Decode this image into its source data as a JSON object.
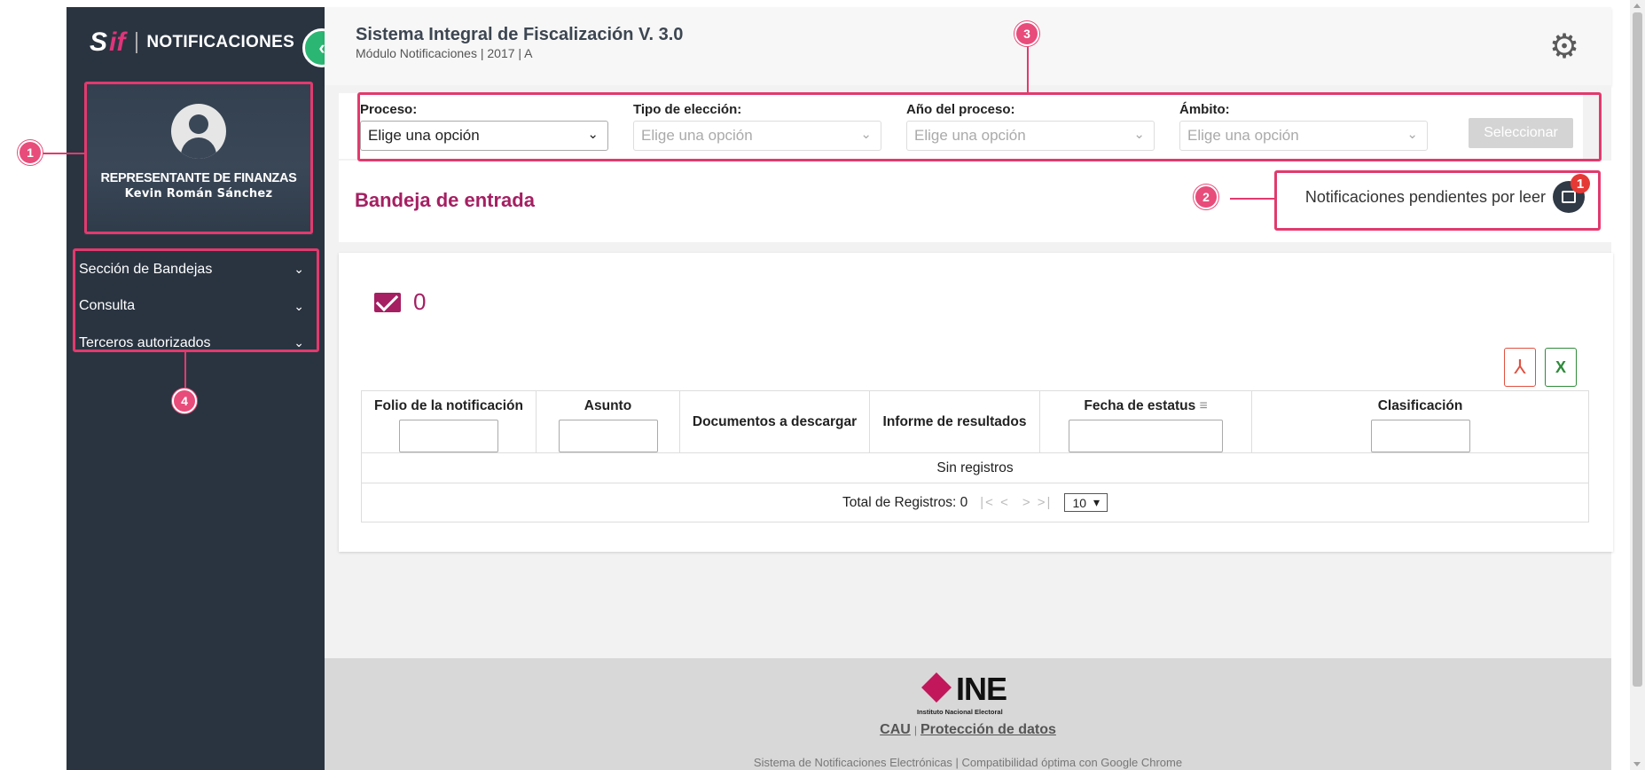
{
  "sidebar": {
    "logo_s": "S",
    "logo_if": "if",
    "title": "NOTIFICACIONES",
    "collapse_glyph": "‹",
    "profile": {
      "role": "REPRESENTANTE DE FINANZAS",
      "name": "Kevin Román Sánchez"
    },
    "menu": [
      {
        "label": "Sección de Bandejas",
        "chevron": "⌄"
      },
      {
        "label": "Consulta",
        "chevron": "⌄"
      },
      {
        "label": "Terceros autorizados",
        "chevron": "⌄"
      }
    ]
  },
  "header": {
    "title": "Sistema Integral de Fiscalización V. 3.0",
    "subtitle": "Módulo Notificaciones | 2017 | A",
    "settings_icon": "gear-icon"
  },
  "filters": {
    "proceso": {
      "label": "Proceso:",
      "value": "Elige una opción"
    },
    "tipo": {
      "label": "Tipo de elección:",
      "value": "Elige una opción"
    },
    "anio": {
      "label": "Año del proceso:",
      "value": "Elige una opción"
    },
    "ambito": {
      "label": "Ámbito:",
      "value": "Elige una opción"
    },
    "button": "Seleccionar"
  },
  "inbox": {
    "title": "Bandeja de entrada",
    "pending_label": "Notificaciones pendientes por leer",
    "pending_count": "1",
    "mail_count": "0"
  },
  "table": {
    "columns": [
      "Folio de la notificación",
      "Asunto",
      "Documentos a descargar",
      "Informe de resultados",
      "Fecha de estatus",
      "Clasificación"
    ],
    "sort_glyph": "≡",
    "empty": "Sin registros",
    "total_label": "Total de Registros: 0",
    "pager_first_prev": "|< <",
    "pager_next_last": "> >|",
    "page_size": "10",
    "page_size_arrow": "▾"
  },
  "exports": {
    "pdf_glyph": "⅄",
    "xls_glyph": "X"
  },
  "footer": {
    "logo": "INE",
    "logo_sub": "Instituto Nacional Electoral",
    "link_cau": "CAU",
    "link_sep": "|",
    "link_privacy": "Protección de datos",
    "note": "Sistema de Notificaciones Electrónicas | Compatibilidad óptima con Google Chrome"
  },
  "markers": [
    "1",
    "2",
    "3",
    "4"
  ],
  "colors": {
    "sidebar": "#2a3441",
    "accent": "#a51f62",
    "marker": "#e23a6e",
    "collapse": "#2bb673"
  }
}
